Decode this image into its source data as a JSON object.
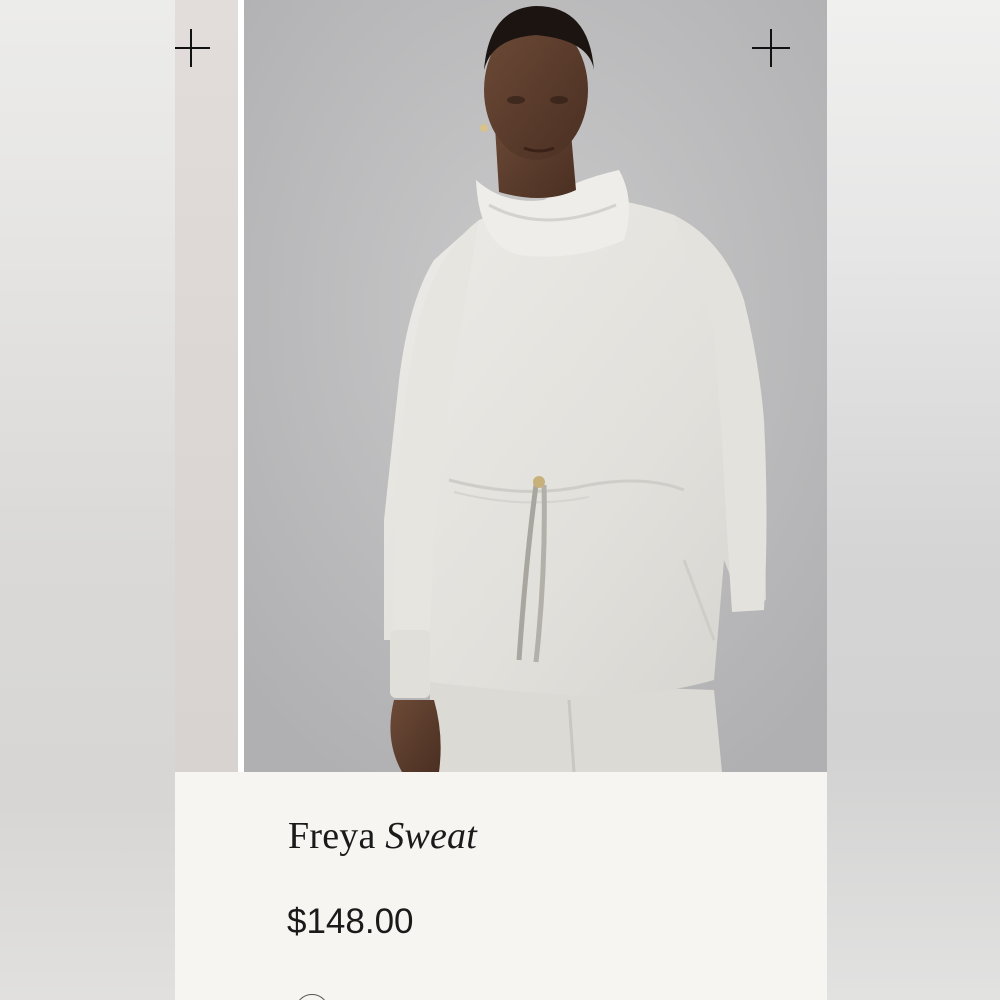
{
  "product": {
    "name_plain": "Freya",
    "name_italic": "Sweat",
    "price": "$148.00"
  },
  "gallery": {
    "main_image_alt": "Model wearing heather grey cowl neck drawstring sweat top",
    "left_add_icon": "plus-icon",
    "right_add_icon": "plus-icon"
  },
  "colors": {
    "card_background": "#f6f5f2",
    "photo_background": "#bcbcbe",
    "garment": "#e6e4df",
    "text": "#1a1a1a"
  }
}
